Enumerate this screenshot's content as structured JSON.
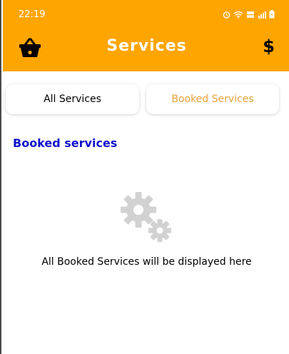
{
  "status_bar": {
    "time": "22:19",
    "icons": [
      "alarm-icon",
      "wifi-icon",
      "volte-icon",
      "signal-icon",
      "battery-icon"
    ]
  },
  "app_bar": {
    "title": "Services",
    "left_icon": "basket-icon",
    "right_label": "$",
    "background": "#FFA500"
  },
  "tabs": [
    {
      "label": "All Services",
      "selected": false
    },
    {
      "label": "Booked Services",
      "selected": true
    }
  ],
  "section": {
    "title": "Booked services",
    "title_color": "#1010CC"
  },
  "empty_state": {
    "icon": "gears-icon",
    "message": "All Booked Services will be displayed here"
  }
}
